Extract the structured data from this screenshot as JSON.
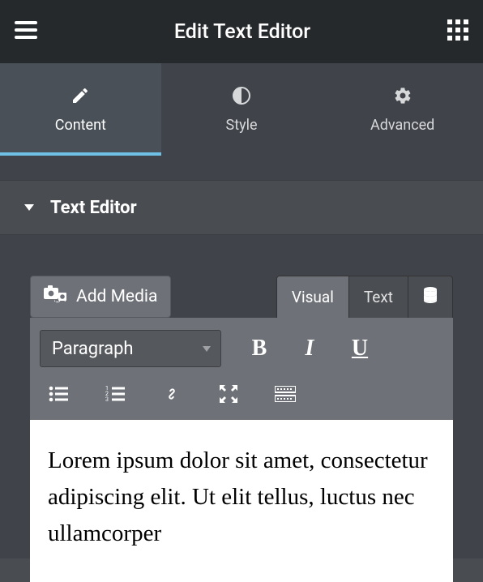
{
  "header": {
    "title": "Edit Text Editor"
  },
  "tabs": [
    {
      "label": "Content"
    },
    {
      "label": "Style"
    },
    {
      "label": "Advanced"
    }
  ],
  "section": {
    "title": "Text Editor"
  },
  "editor": {
    "add_media_label": "Add Media",
    "mode_tabs": {
      "visual": "Visual",
      "text": "Text"
    },
    "format_select": "Paragraph",
    "content": "Lorem ipsum dolor sit amet, consectetur adipiscing elit. Ut elit tellus, luctus nec ullamcorper"
  }
}
